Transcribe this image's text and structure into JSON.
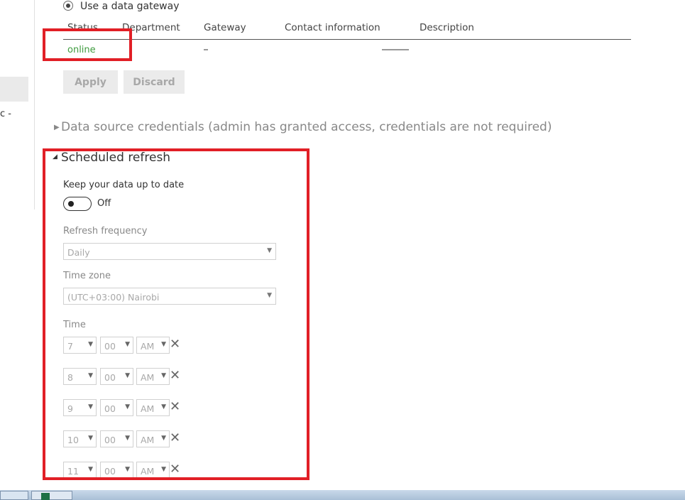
{
  "nav": {
    "fragment": "c -"
  },
  "gateway": {
    "radio_label": "Use a data gateway",
    "columns": [
      "Status",
      "Department",
      "Gateway",
      "Contact information",
      "Description"
    ],
    "row": {
      "status": "online"
    },
    "apply_label": "Apply",
    "discard_label": "Discard"
  },
  "credentials": {
    "title": "Data source credentials (admin has granted access, credentials are not required)"
  },
  "scheduled": {
    "title": "Scheduled refresh",
    "keep_label": "Keep your data up to date",
    "toggle_state": "Off",
    "frequency_label": "Refresh frequency",
    "frequency_value": "Daily",
    "timezone_label": "Time zone",
    "timezone_value": "(UTC+03:00) Nairobi",
    "time_label": "Time",
    "times": [
      {
        "hour": "7",
        "minute": "00",
        "ampm": "AM"
      },
      {
        "hour": "8",
        "minute": "00",
        "ampm": "AM"
      },
      {
        "hour": "9",
        "minute": "00",
        "ampm": "AM"
      },
      {
        "hour": "10",
        "minute": "00",
        "ampm": "AM"
      },
      {
        "hour": "11",
        "minute": "00",
        "ampm": "AM"
      }
    ]
  },
  "colors": {
    "online": "#3e9b3e",
    "highlight": "#e11f26"
  }
}
